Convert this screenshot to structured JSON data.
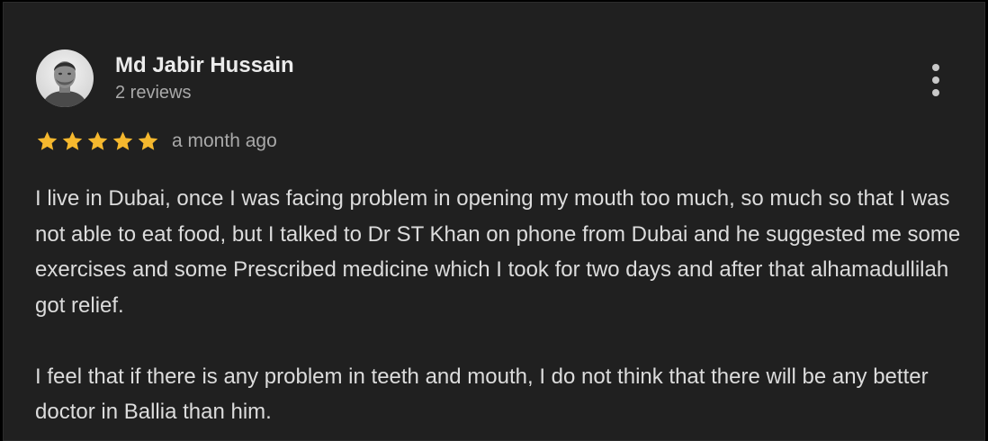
{
  "review": {
    "author_name": "Md Jabir Hussain",
    "author_reviews": "2 reviews",
    "rating": 5,
    "rating_max": 5,
    "time_ago": "a month ago",
    "paragraphs": [
      "I live in Dubai, once I was facing problem in opening my mouth too much, so much so that I was not able to eat food, but I talked to Dr ST Khan on phone from Dubai and he suggested me some exercises and some Prescribed medicine which I took for two days and after that alhamadullilah got relief.",
      "I feel that if there is any problem in teeth and mouth, I do not think that there will be any better doctor in Ballia than him."
    ]
  },
  "icons": {
    "menu": "more-vertical-icon",
    "star": "star-icon"
  },
  "colors": {
    "background": "#202020",
    "star": "#f5b82e",
    "name": "#ececec",
    "secondary_text": "#a9a9a9",
    "body_text": "#dcdcdc"
  }
}
